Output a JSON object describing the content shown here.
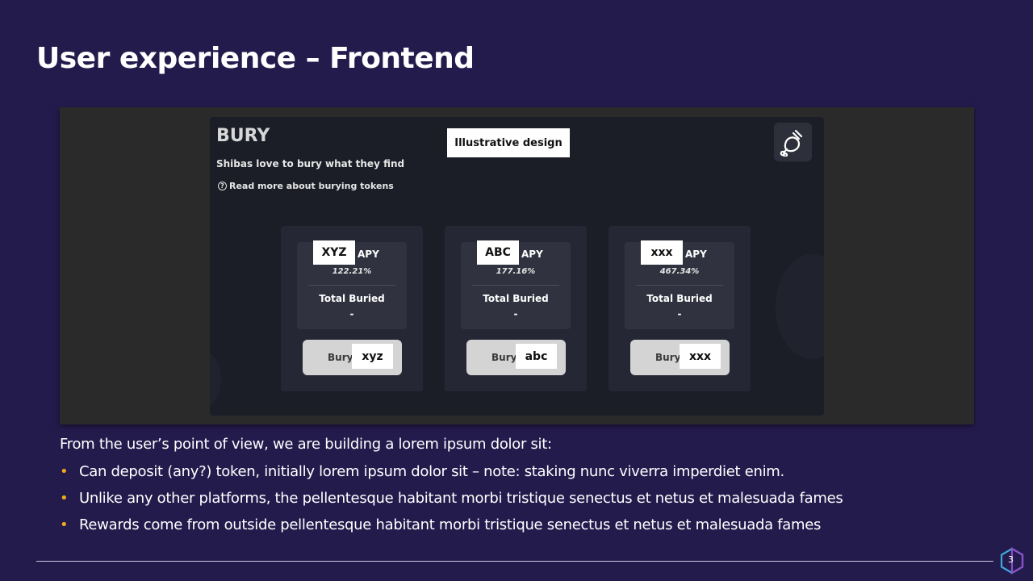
{
  "slide": {
    "title": "User experience – Frontend",
    "page_number": "3"
  },
  "app": {
    "title": "BURY",
    "subtitle": "Shibas love to bury what they find",
    "read_more": "Read more about burying tokens",
    "overlay_label": "Illustrative design",
    "icons": {
      "help": "question-circle-icon",
      "settings": "bone-icon"
    }
  },
  "cards": [
    {
      "symbol": "XYZ",
      "apy_label": "APY",
      "apy_value": "122.21%",
      "total_label": "Total Buried",
      "total_value": "-",
      "bury_label": "Bury",
      "token_name": "xyz"
    },
    {
      "symbol": "ABC",
      "apy_label": "APY",
      "apy_value": "177.16%",
      "total_label": "Total Buried",
      "total_value": "-",
      "bury_label": "Bury",
      "token_name": "abc"
    },
    {
      "symbol": "xxx",
      "apy_label": "APY",
      "apy_value": "467.34%",
      "total_label": "Total Buried",
      "total_value": "-",
      "bury_label": "Bury",
      "token_name": "xxx"
    }
  ],
  "body": {
    "intro": "From the user’s point of view, we are building a lorem ipsum dolor sit:",
    "bullets": [
      "Can deposit (any?) token, initially lorem ipsum dolor sit – note: staking nunc viverra imperdiet enim.",
      "Unlike any other platforms, the pellentesque habitant morbi tristique senectus et netus et malesuada fames",
      "Rewards come from outside pellentesque habitant morbi tristique senectus et netus et malesuada fames"
    ]
  },
  "colors": {
    "background": "#241b4d",
    "bullet_accent": "#f0a91b",
    "app_background": "#1b1e27"
  }
}
